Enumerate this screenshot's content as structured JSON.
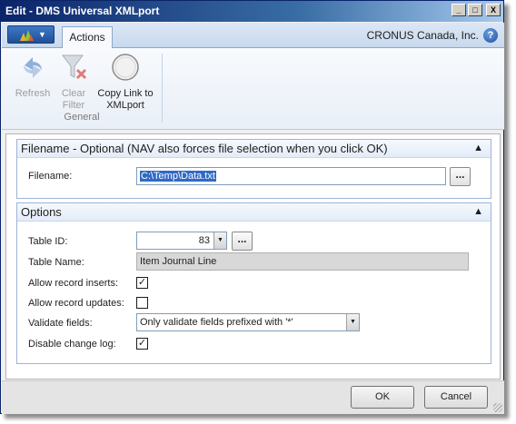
{
  "window": {
    "title": "Edit - DMS Universal XMLport",
    "minimize_glyph": "_",
    "maximize_glyph": "□",
    "close_glyph": "X"
  },
  "tabs": [
    {
      "label": "Actions"
    }
  ],
  "app_menu": {
    "caret": "▼",
    "icon": "dynamics-logo-icon"
  },
  "company": "CRONUS Canada, Inc.",
  "help_glyph": "?",
  "ribbon": {
    "refresh_label": "Refresh",
    "clear_filter_label": "Clear\nFilter",
    "copy_link_label": "Copy Link to\nXMLport",
    "group_label": "General"
  },
  "filename_section": {
    "title": "Filename - Optional (NAV also forces file selection when you click OK)",
    "collapse_glyph": "▲",
    "filename_label": "Filename:",
    "filename_value": "C:\\Temp\\Data.txt",
    "lookup_glyph": "..."
  },
  "options_section": {
    "title": "Options",
    "collapse_glyph": "▲",
    "table_id_label": "Table ID:",
    "table_id_value": "83",
    "table_name_label": "Table Name:",
    "table_name_value": "Item Journal Line",
    "allow_inserts_label": "Allow record inserts:",
    "allow_inserts_checked": true,
    "allow_updates_label": "Allow record updates:",
    "allow_updates_checked": false,
    "validate_label": "Validate fields:",
    "validate_value": "Only validate fields prefixed with '*'",
    "disable_log_label": "Disable change log:",
    "disable_log_checked": true,
    "lookup_glyph": "...",
    "dropdown_glyph": "▼",
    "check_glyph": "✓"
  },
  "footer": {
    "ok_label": "OK",
    "cancel_label": "Cancel"
  }
}
